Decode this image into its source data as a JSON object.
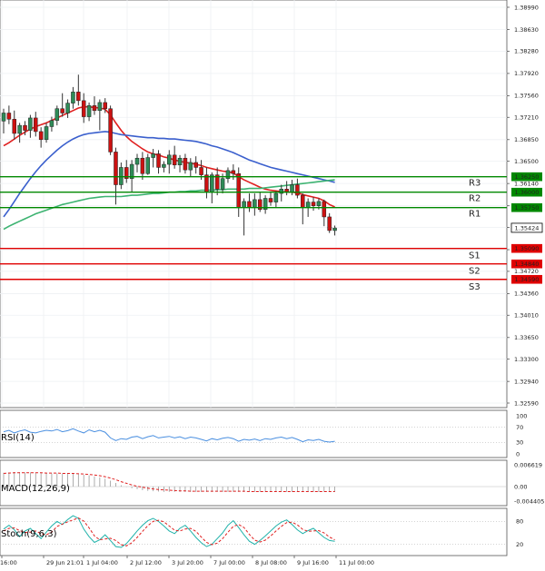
{
  "chart_data": {
    "type": "candlestick",
    "price_axis": {
      "ticks": [
        "1.38990",
        "1.38630",
        "1.38280",
        "1.37920",
        "1.37560",
        "1.37210",
        "1.36850",
        "1.36500",
        "1.36140",
        "1.35780",
        "1.35430",
        "1.35070",
        "1.34720",
        "1.34360",
        "1.34010",
        "1.33650",
        "1.33300",
        "1.32940",
        "1.32590"
      ],
      "min": 1.3259,
      "max": 1.3899
    },
    "time_axis": [
      "16:00",
      "29 Jun 21:01",
      "1 Jul 04:00",
      "2 Jul 12:00",
      "3 Jul 20:00",
      "7 Jul 00:00",
      "8 Jul 08:00",
      "9 Jul 16:00",
      "11 Jul 00:00"
    ],
    "current_price": "1.35424",
    "levels": [
      {
        "name": "R3",
        "value": 1.3625,
        "label": "1.36250",
        "color": "#008800"
      },
      {
        "name": "R2",
        "value": 1.36,
        "label": "1.36000",
        "color": "#008800"
      },
      {
        "name": "R1",
        "value": 1.3575,
        "label": "1.35750",
        "color": "#008800"
      },
      {
        "name": "S1",
        "value": 1.3509,
        "label": "1.35090",
        "color": "#e00000"
      },
      {
        "name": "S2",
        "value": 1.3484,
        "label": "1.34840",
        "color": "#e00000"
      },
      {
        "name": "S3",
        "value": 1.3459,
        "label": "1.34590",
        "color": "#e00000"
      }
    ],
    "candles": [
      {
        "o": 1.3715,
        "h": 1.3735,
        "l": 1.3695,
        "c": 1.3728
      },
      {
        "o": 1.3728,
        "h": 1.374,
        "l": 1.371,
        "c": 1.3718
      },
      {
        "o": 1.3718,
        "h": 1.3732,
        "l": 1.3685,
        "c": 1.3695
      },
      {
        "o": 1.3695,
        "h": 1.3712,
        "l": 1.368,
        "c": 1.3708
      },
      {
        "o": 1.3708,
        "h": 1.3715,
        "l": 1.3692,
        "c": 1.37
      },
      {
        "o": 1.37,
        "h": 1.3725,
        "l": 1.3688,
        "c": 1.372
      },
      {
        "o": 1.372,
        "h": 1.373,
        "l": 1.369,
        "c": 1.3698
      },
      {
        "o": 1.3698,
        "h": 1.3705,
        "l": 1.3672,
        "c": 1.3685
      },
      {
        "o": 1.3685,
        "h": 1.3712,
        "l": 1.368,
        "c": 1.3706
      },
      {
        "o": 1.3706,
        "h": 1.3722,
        "l": 1.3698,
        "c": 1.3716
      },
      {
        "o": 1.3716,
        "h": 1.374,
        "l": 1.3708,
        "c": 1.3735
      },
      {
        "o": 1.3735,
        "h": 1.376,
        "l": 1.3722,
        "c": 1.3728
      },
      {
        "o": 1.3728,
        "h": 1.375,
        "l": 1.372,
        "c": 1.3744
      },
      {
        "o": 1.3744,
        "h": 1.377,
        "l": 1.3735,
        "c": 1.3762
      },
      {
        "o": 1.3762,
        "h": 1.379,
        "l": 1.374,
        "c": 1.3748
      },
      {
        "o": 1.3748,
        "h": 1.376,
        "l": 1.3712,
        "c": 1.3722
      },
      {
        "o": 1.3722,
        "h": 1.3745,
        "l": 1.3715,
        "c": 1.374
      },
      {
        "o": 1.374,
        "h": 1.3755,
        "l": 1.3725,
        "c": 1.3732
      },
      {
        "o": 1.3732,
        "h": 1.375,
        "l": 1.37,
        "c": 1.3745
      },
      {
        "o": 1.3745,
        "h": 1.3752,
        "l": 1.3728,
        "c": 1.3735
      },
      {
        "o": 1.3735,
        "h": 1.374,
        "l": 1.366,
        "c": 1.3665
      },
      {
        "o": 1.3665,
        "h": 1.3672,
        "l": 1.358,
        "c": 1.3612
      },
      {
        "o": 1.3612,
        "h": 1.3648,
        "l": 1.3605,
        "c": 1.364
      },
      {
        "o": 1.364,
        "h": 1.3652,
        "l": 1.3615,
        "c": 1.3622
      },
      {
        "o": 1.3622,
        "h": 1.3652,
        "l": 1.36,
        "c": 1.3645
      },
      {
        "o": 1.3645,
        "h": 1.3662,
        "l": 1.3632,
        "c": 1.3655
      },
      {
        "o": 1.3655,
        "h": 1.3665,
        "l": 1.362,
        "c": 1.363
      },
      {
        "o": 1.363,
        "h": 1.3662,
        "l": 1.3628,
        "c": 1.3656
      },
      {
        "o": 1.3656,
        "h": 1.367,
        "l": 1.364,
        "c": 1.3662
      },
      {
        "o": 1.3662,
        "h": 1.3668,
        "l": 1.363,
        "c": 1.364
      },
      {
        "o": 1.364,
        "h": 1.365,
        "l": 1.3632,
        "c": 1.3645
      },
      {
        "o": 1.3645,
        "h": 1.3668,
        "l": 1.363,
        "c": 1.366
      },
      {
        "o": 1.366,
        "h": 1.3675,
        "l": 1.3638,
        "c": 1.3644
      },
      {
        "o": 1.3644,
        "h": 1.366,
        "l": 1.3632,
        "c": 1.3655
      },
      {
        "o": 1.3655,
        "h": 1.3662,
        "l": 1.363,
        "c": 1.3636
      },
      {
        "o": 1.3636,
        "h": 1.3655,
        "l": 1.3625,
        "c": 1.3648
      },
      {
        "o": 1.3648,
        "h": 1.3658,
        "l": 1.363,
        "c": 1.364
      },
      {
        "o": 1.364,
        "h": 1.3652,
        "l": 1.362,
        "c": 1.3628
      },
      {
        "o": 1.3628,
        "h": 1.364,
        "l": 1.359,
        "c": 1.36
      },
      {
        "o": 1.36,
        "h": 1.3632,
        "l": 1.3582,
        "c": 1.3628
      },
      {
        "o": 1.3628,
        "h": 1.364,
        "l": 1.3595,
        "c": 1.3605
      },
      {
        "o": 1.3605,
        "h": 1.363,
        "l": 1.3598,
        "c": 1.3622
      },
      {
        "o": 1.3622,
        "h": 1.364,
        "l": 1.3615,
        "c": 1.3635
      },
      {
        "o": 1.3635,
        "h": 1.3645,
        "l": 1.362,
        "c": 1.363
      },
      {
        "o": 1.363,
        "h": 1.364,
        "l": 1.356,
        "c": 1.3575
      },
      {
        "o": 1.3575,
        "h": 1.359,
        "l": 1.353,
        "c": 1.3585
      },
      {
        "o": 1.3585,
        "h": 1.3598,
        "l": 1.3568,
        "c": 1.3575
      },
      {
        "o": 1.3575,
        "h": 1.3598,
        "l": 1.3562,
        "c": 1.3588
      },
      {
        "o": 1.3588,
        "h": 1.36,
        "l": 1.3568,
        "c": 1.3572
      },
      {
        "o": 1.3572,
        "h": 1.3595,
        "l": 1.3565,
        "c": 1.359
      },
      {
        "o": 1.359,
        "h": 1.36,
        "l": 1.3578,
        "c": 1.3584
      },
      {
        "o": 1.3584,
        "h": 1.3602,
        "l": 1.3575,
        "c": 1.3598
      },
      {
        "o": 1.3598,
        "h": 1.3612,
        "l": 1.3585,
        "c": 1.3605
      },
      {
        "o": 1.3605,
        "h": 1.3618,
        "l": 1.3595,
        "c": 1.36
      },
      {
        "o": 1.36,
        "h": 1.362,
        "l": 1.3595,
        "c": 1.3612
      },
      {
        "o": 1.3612,
        "h": 1.3622,
        "l": 1.359,
        "c": 1.3595
      },
      {
        "o": 1.3595,
        "h": 1.3598,
        "l": 1.3548,
        "c": 1.3575
      },
      {
        "o": 1.3575,
        "h": 1.359,
        "l": 1.356,
        "c": 1.3584
      },
      {
        "o": 1.3584,
        "h": 1.3592,
        "l": 1.357,
        "c": 1.3578
      },
      {
        "o": 1.3578,
        "h": 1.359,
        "l": 1.3572,
        "c": 1.3585
      },
      {
        "o": 1.3585,
        "h": 1.3588,
        "l": 1.3545,
        "c": 1.356
      },
      {
        "o": 1.356,
        "h": 1.3566,
        "l": 1.3534,
        "c": 1.3538
      },
      {
        "o": 1.3538,
        "h": 1.3546,
        "l": 1.353,
        "c": 1.3542
      }
    ],
    "series": [
      {
        "name": "MA fast",
        "color": "#e02020",
        "values": [
          1.3675,
          1.368,
          1.3686,
          1.3692,
          1.3697,
          1.3702,
          1.3706,
          1.3709,
          1.3712,
          1.3716,
          1.372,
          1.3724,
          1.3728,
          1.3732,
          1.3736,
          1.3738,
          1.3738,
          1.3737,
          1.3736,
          1.3734,
          1.3725,
          1.3712,
          1.37,
          1.369,
          1.3682,
          1.3676,
          1.367,
          1.3665,
          1.3662,
          1.366,
          1.3657,
          1.3655,
          1.3652,
          1.365,
          1.3648,
          1.3647,
          1.3645,
          1.3643,
          1.364,
          1.3638,
          1.3636,
          1.3634,
          1.3633,
          1.3631,
          1.3625,
          1.362,
          1.3616,
          1.3612,
          1.3608,
          1.3605,
          1.3603,
          1.3602,
          1.3601,
          1.36,
          1.36,
          1.3599,
          1.3596,
          1.3594,
          1.3592,
          1.359,
          1.3586,
          1.358,
          1.3576
        ]
      },
      {
        "name": "MA mid",
        "color": "#3a5fcd",
        "values": [
          1.356,
          1.3572,
          1.3585,
          1.3598,
          1.361,
          1.3622,
          1.3633,
          1.3643,
          1.3652,
          1.366,
          1.3668,
          1.3675,
          1.3681,
          1.3686,
          1.369,
          1.3693,
          1.3695,
          1.3696,
          1.3697,
          1.3698,
          1.3697,
          1.3695,
          1.3693,
          1.3692,
          1.3691,
          1.369,
          1.3689,
          1.3688,
          1.3688,
          1.3687,
          1.3687,
          1.3686,
          1.3686,
          1.3685,
          1.3684,
          1.3683,
          1.3682,
          1.368,
          1.3678,
          1.3675,
          1.3673,
          1.367,
          1.3667,
          1.3664,
          1.366,
          1.3656,
          1.3652,
          1.3649,
          1.3646,
          1.3643,
          1.364,
          1.3638,
          1.3636,
          1.3634,
          1.3632,
          1.363,
          1.3628,
          1.3626,
          1.3624,
          1.3622,
          1.362,
          1.3618,
          1.3616
        ]
      },
      {
        "name": "MA slow",
        "color": "#3cb371",
        "values": [
          1.354,
          1.3545,
          1.3549,
          1.3553,
          1.3557,
          1.3561,
          1.3565,
          1.3568,
          1.3571,
          1.3574,
          1.3577,
          1.358,
          1.3582,
          1.3584,
          1.3586,
          1.3588,
          1.359,
          1.3591,
          1.3592,
          1.3593,
          1.3593,
          1.3593,
          1.3593,
          1.3594,
          1.3595,
          1.3595,
          1.3596,
          1.3597,
          1.3598,
          1.3598,
          1.3599,
          1.36,
          1.36,
          1.3601,
          1.3601,
          1.3602,
          1.3602,
          1.3603,
          1.3603,
          1.3603,
          1.3604,
          1.3604,
          1.3605,
          1.3605,
          1.3605,
          1.3605,
          1.3606,
          1.3606,
          1.3606,
          1.3607,
          1.3608,
          1.3609,
          1.361,
          1.3611,
          1.3612,
          1.3613,
          1.3614,
          1.3615,
          1.3616,
          1.3617,
          1.3618,
          1.3619,
          1.362
        ]
      }
    ],
    "indicators": {
      "rsi": {
        "label": "RSI(14)",
        "ticks": [
          "100",
          "70",
          "30",
          "0"
        ],
        "min": 0,
        "max": 100,
        "values": [
          58,
          62,
          55,
          60,
          63,
          57,
          55,
          59,
          62,
          60,
          64,
          58,
          61,
          66,
          60,
          55,
          63,
          58,
          62,
          57,
          42,
          35,
          40,
          38,
          44,
          46,
          40,
          45,
          48,
          42,
          44,
          46,
          42,
          45,
          40,
          44,
          42,
          38,
          34,
          40,
          37,
          41,
          43,
          40,
          33,
          38,
          36,
          39,
          35,
          40,
          38,
          42,
          44,
          40,
          43,
          38,
          32,
          37,
          35,
          38,
          33,
          31,
          33
        ]
      },
      "macd": {
        "label": "MACD(12,26,9)",
        "ticks": [
          "0.006619",
          "0.00",
          "-0.004405"
        ],
        "min": -0.004405,
        "max": 0.006619,
        "hist": [
          0.0042,
          0.0043,
          0.0044,
          0.0044,
          0.0043,
          0.0043,
          0.0042,
          0.0041,
          0.0041,
          0.004,
          0.004,
          0.004,
          0.0039,
          0.0039,
          0.0038,
          0.0036,
          0.0034,
          0.0031,
          0.0028,
          0.0024,
          0.0018,
          0.0011,
          0.0004,
          -0.0001,
          -0.0005,
          -0.0008,
          -0.0011,
          -0.0013,
          -0.0014,
          -0.0015,
          -0.0016,
          -0.0016,
          -0.0016,
          -0.0016,
          -0.0016,
          -0.0016,
          -0.0016,
          -0.0016,
          -0.0016,
          -0.0016,
          -0.0016,
          -0.0016,
          -0.0016,
          -0.0016,
          -0.0016,
          -0.0016,
          -0.0016,
          -0.0016,
          -0.0016,
          -0.0016,
          -0.0016,
          -0.0016,
          -0.0016,
          -0.0016,
          -0.0016,
          -0.0016,
          -0.0016,
          -0.0016,
          -0.0016,
          -0.0016,
          -0.0016,
          -0.0016,
          -0.0016
        ],
        "signal": [
          0.004,
          0.0041,
          0.0042,
          0.0042,
          0.0042,
          0.0042,
          0.0042,
          0.0042,
          0.0041,
          0.0041,
          0.0041,
          0.004,
          0.004,
          0.004,
          0.0039,
          0.0038,
          0.0037,
          0.0035,
          0.0033,
          0.003,
          0.0026,
          0.0021,
          0.0015,
          0.001,
          0.0005,
          0.0001,
          -0.0002,
          -0.0005,
          -0.0007,
          -0.0009,
          -0.001,
          -0.0011,
          -0.0012,
          -0.0013,
          -0.0013,
          -0.0014,
          -0.0014,
          -0.0014,
          -0.0014,
          -0.0014,
          -0.0014,
          -0.0014,
          -0.0014,
          -0.0014,
          -0.0014,
          -0.0014,
          -0.0015,
          -0.0015,
          -0.0015,
          -0.0015,
          -0.0015,
          -0.0015,
          -0.0015,
          -0.0015,
          -0.0015,
          -0.0015,
          -0.0015,
          -0.0015,
          -0.0015,
          -0.0015,
          -0.0015,
          -0.0015,
          -0.0015
        ]
      },
      "stoch": {
        "label": "Stoch(9,6,3)",
        "ticks": [
          "80",
          "20"
        ],
        "min": 0,
        "max": 100,
        "k": [
          60,
          70,
          58,
          40,
          55,
          62,
          48,
          35,
          52,
          68,
          80,
          72,
          85,
          95,
          88,
          60,
          40,
          25,
          32,
          45,
          30,
          14,
          12,
          22,
          38,
          55,
          70,
          82,
          88,
          80,
          68,
          55,
          48,
          62,
          70,
          55,
          38,
          24,
          14,
          20,
          35,
          50,
          70,
          82,
          64,
          45,
          28,
          20,
          30,
          42,
          55,
          68,
          78,
          84,
          72,
          58,
          48,
          56,
          62,
          50,
          38,
          30,
          28
        ],
        "d": [
          55,
          62,
          63,
          56,
          51,
          52,
          55,
          48,
          45,
          52,
          67,
          73,
          79,
          84,
          89,
          81,
          63,
          42,
          32,
          34,
          36,
          30,
          19,
          16,
          24,
          38,
          54,
          69,
          80,
          83,
          79,
          68,
          57,
          55,
          60,
          62,
          54,
          39,
          25,
          19,
          23,
          35,
          52,
          67,
          72,
          64,
          46,
          31,
          26,
          31,
          42,
          55,
          67,
          77,
          78,
          71,
          59,
          54,
          55,
          56,
          50,
          39,
          32
        ]
      }
    }
  }
}
